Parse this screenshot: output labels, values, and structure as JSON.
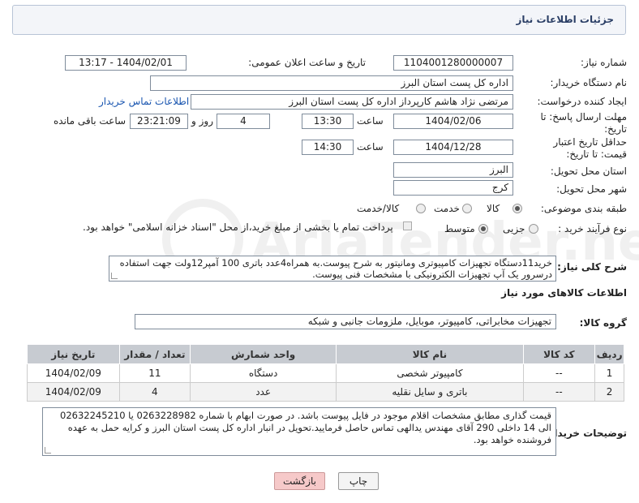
{
  "header": {
    "title": "جزئیات اطلاعات نیاز"
  },
  "fields": {
    "need_number_label": "شماره نیاز:",
    "need_number": "1104001280000007",
    "announce_label": "تاریخ و ساعت اعلان عمومی:",
    "announce_value": "1404/02/01 - 13:17",
    "buyer_org_label": "نام دستگاه خریدار:",
    "buyer_org": "اداره کل پست استان البرز",
    "creator_label": "ایجاد کننده درخواست:",
    "creator": "مرتضی  نژاد هاشم کارپرداز اداره کل پست استان البرز",
    "contact_link": "اطلاعات تماس خریدار",
    "deadline_label": "مهلت ارسال پاسخ: تا تاریخ:",
    "deadline_date": "1404/02/06",
    "time_label": "ساعت",
    "deadline_time": "13:30",
    "days_value": "4",
    "days_label": "روز و",
    "remaining_time": "23:21:09",
    "remaining_label": "ساعت باقی مانده",
    "validity_label": "حداقل تاریخ اعتبار قیمت: تا تاریخ:",
    "validity_date": "1404/12/28",
    "validity_time": "14:30",
    "province_label": "استان محل تحویل:",
    "province": "البرز",
    "city_label": "شهر محل تحویل:",
    "city": "کرج",
    "category_label": "طبقه بندی موضوعی:",
    "category_options": [
      "کالا",
      "خدمت",
      "کالا/خدمت"
    ],
    "process_label": "نوع فرآیند خرید :",
    "process_options": [
      "جزیی",
      "متوسط"
    ],
    "payment_note": "پرداخت تمام یا بخشی از مبلغ خرید،از محل \"اسناد خزانه اسلامی\" خواهد بود.",
    "description_label": "شرح کلی نیاز:",
    "description": "خرید11دستگاه تجهیزات کامپیوتری ومانیتور به شرح پیوست.به همراه4عدد باتری 100 آمپر12ولت جهت استفاده درسرور یک آپ تجهیزات الکترونیکی با مشخصات فنی پیوست."
  },
  "goods": {
    "section_title": "اطلاعات کالاهای مورد نیاز",
    "group_label": "گروه کالا:",
    "group_value": "تجهیزات مخابراتی، کامپیوتر، موبایل، ملزومات جانبی و شبکه",
    "columns": [
      "ردیف",
      "کد کالا",
      "نام کالا",
      "واحد شمارش",
      "تعداد / مقدار",
      "تاریخ نیاز"
    ],
    "rows": [
      [
        "1",
        "--",
        "کامپیوتر شخصی",
        "دستگاه",
        "11",
        "1404/02/09"
      ],
      [
        "2",
        "--",
        "باتری و سایل نقلیه",
        "عدد",
        "4",
        "1404/02/09"
      ]
    ]
  },
  "buyer_notes": {
    "label": "توضیحات خریدار:",
    "text": "قیمت گذاری مطابق مشخصات اقلام موجود در فایل پیوست باشد. در صورت ابهام با شماره 0263228982 یا 02632245210 الی 14 داخلی 290 آقای مهندس یدالهی تماس حاصل فرمایید.تحویل در  انبار اداره کل پست استان البرز و کرایه حمل به عهده فروشنده خواهد بود."
  },
  "buttons": {
    "print": "چاپ",
    "back": "بازگشت"
  },
  "watermark": "AriaTender.neT"
}
